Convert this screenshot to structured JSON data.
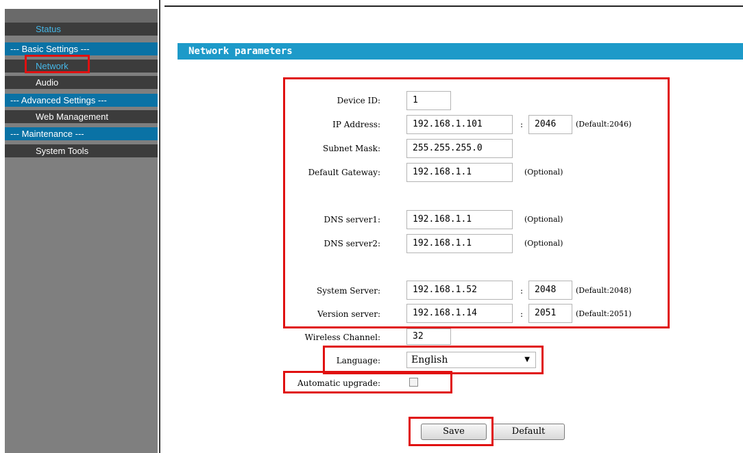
{
  "sidebar": {
    "items": [
      {
        "label": "Status",
        "kind": "status"
      },
      {
        "label": "--- Basic Settings ---",
        "kind": "head"
      },
      {
        "label": "Network",
        "kind": "active"
      },
      {
        "label": "Audio",
        "kind": "link"
      },
      {
        "label": "--- Advanced Settings ---",
        "kind": "head"
      },
      {
        "label": "Web Management",
        "kind": "link"
      },
      {
        "label": "--- Maintenance ---",
        "kind": "head"
      },
      {
        "label": "System Tools",
        "kind": "link"
      }
    ]
  },
  "page": {
    "title": "Network parameters"
  },
  "form": {
    "device_id": {
      "label": "Device ID:",
      "value": "1"
    },
    "ip_address": {
      "label": "IP Address:",
      "value": "192.168.1.101",
      "port": "2046",
      "note": "(Default:2046)"
    },
    "subnet_mask": {
      "label": "Subnet Mask:",
      "value": "255.255.255.0"
    },
    "default_gateway": {
      "label": "Default Gateway:",
      "value": "192.168.1.1",
      "note": "(Optional)"
    },
    "dns1": {
      "label": "DNS server1:",
      "value": "192.168.1.1",
      "note": "(Optional)"
    },
    "dns2": {
      "label": "DNS server2:",
      "value": "192.168.1.1",
      "note": "(Optional)"
    },
    "system_server": {
      "label": "System Server:",
      "value": "192.168.1.52",
      "port": "2048",
      "note": "(Default:2048)"
    },
    "version_server": {
      "label": "Version server:",
      "value": "192.168.1.14",
      "port": "2051",
      "note": "(Default:2051)"
    },
    "wireless_channel": {
      "label": "Wireless Channel:",
      "value": "32"
    },
    "language": {
      "label": "Language:",
      "value": "English"
    },
    "auto_upgrade": {
      "label": "Automatic upgrade:",
      "checked": false
    }
  },
  "buttons": {
    "save": "Save",
    "default": "Default"
  },
  "colors": {
    "accent": "#1d9ac9",
    "highlight": "#e01010",
    "sidebar_head": "#0a72a5"
  },
  "icons": {
    "dropdown": "chevron-down-icon"
  }
}
